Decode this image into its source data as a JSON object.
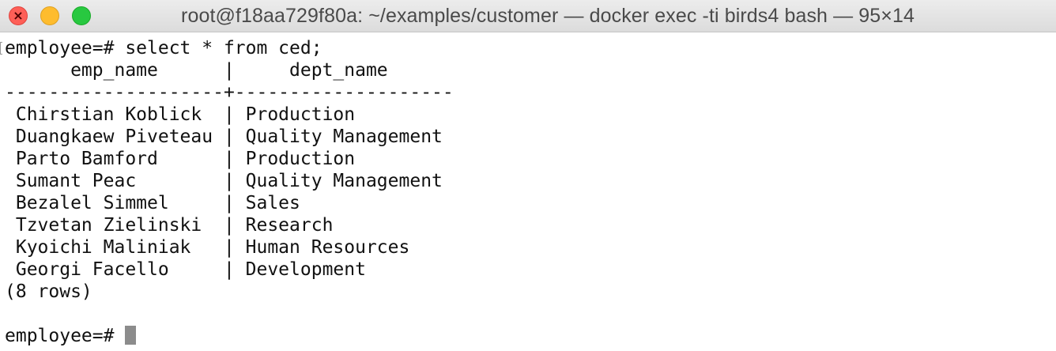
{
  "window": {
    "title": "root@f18aa729f80a: ~/examples/customer — docker exec -ti birds4 bash — 95×14"
  },
  "terminal": {
    "command_line": "employee=# select * from ced;",
    "header": "      emp_name      |     dept_name",
    "separator": "--------------------+--------------------",
    "rows": [
      " Chirstian Koblick  | Production",
      " Duangkaew Piveteau | Quality Management",
      " Parto Bamford      | Production",
      " Sumant Peac        | Quality Management",
      " Bezalel Simmel     | Sales",
      " Tzvetan Zielinski  | Research",
      " Kyoichi Maliniak   | Human Resources",
      " Georgi Facello     | Development"
    ],
    "row_count": "(8 rows)",
    "prompt": "employee=# "
  }
}
